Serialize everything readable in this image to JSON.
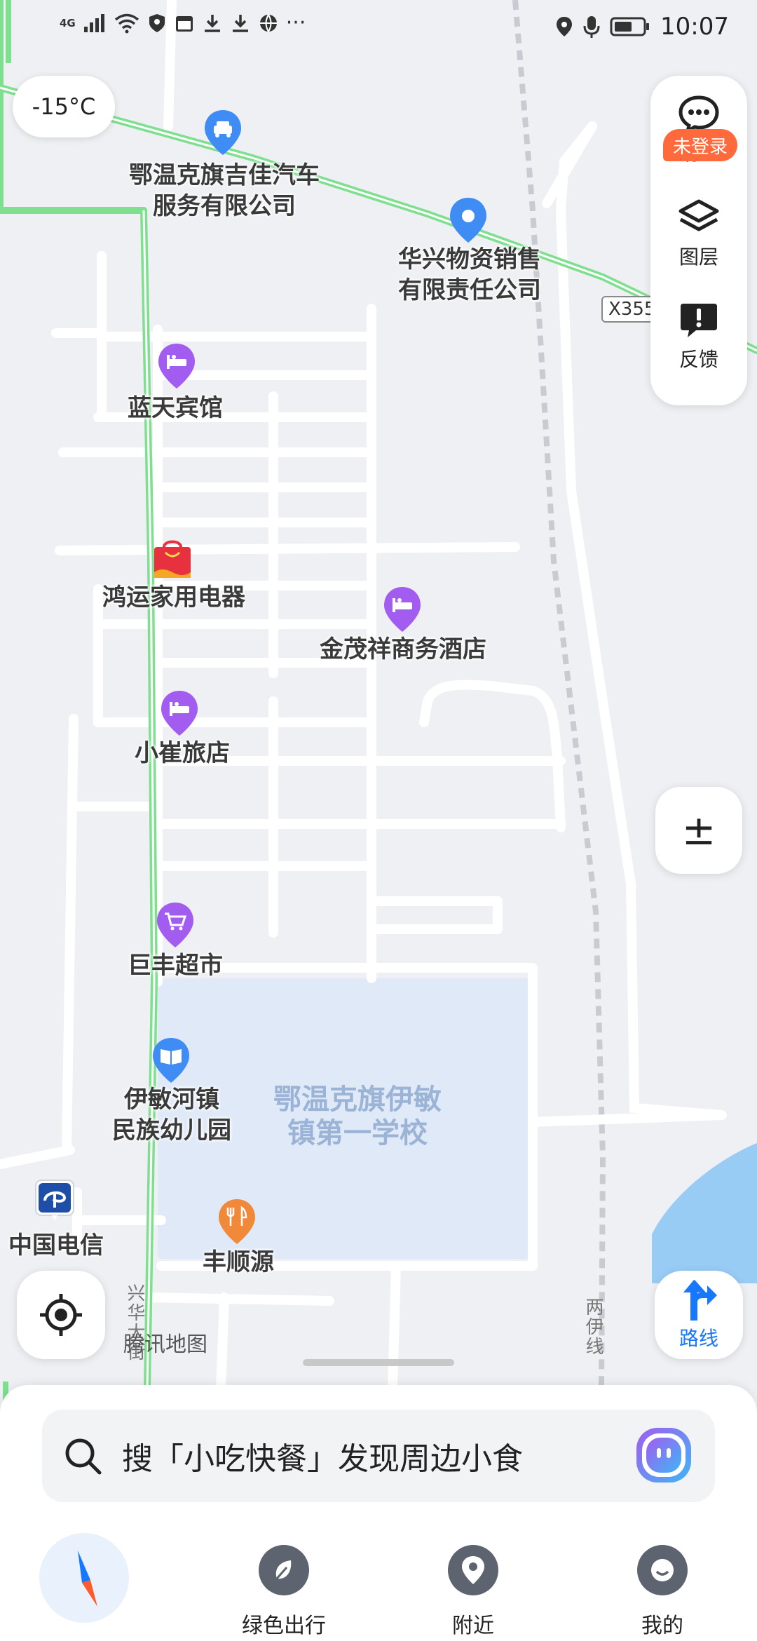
{
  "status_bar": {
    "network": "4G",
    "time": "10:07"
  },
  "weather": {
    "temperature": "-15°C"
  },
  "toolbar": {
    "messages_label": "消息",
    "layers_label": "图层",
    "feedback_label": "反馈"
  },
  "zoom": {
    "label": "±"
  },
  "route": {
    "label": "路线"
  },
  "road": {
    "label": "X355",
    "side_road_1": "兴华大街",
    "side_road_2": "两伊线"
  },
  "pois": {
    "car_company_line1": "鄂温克旗吉佳汽车",
    "car_company_line2": "服务有限公司",
    "material_company_line1": "华兴物资销售",
    "material_company_line2": "有限责任公司",
    "hotel_lantian": "蓝天宾馆",
    "appliance_store": "鸿运家用电器",
    "business_hotel": "金茂祥商务酒店",
    "inn_xiaocui": "小崔旅店",
    "supermarket": "巨丰超市",
    "kindergarten_line1": "伊敏河镇",
    "kindergarten_line2": "民族幼儿园",
    "telecom": "中国电信",
    "restaurant": "丰顺源",
    "school_line1": "鄂温克旗伊敏",
    "school_line2": "镇第一学校"
  },
  "watermark": "腾讯地图",
  "search": {
    "placeholder": "搜「小吃快餐」发现周边小食"
  },
  "nav": {
    "green_travel": "绿色出行",
    "nearby": "附近",
    "mine": "我的",
    "login_badge": "未登录"
  },
  "colors": {
    "map_bg": "#eef0f3",
    "road": "#ffffff",
    "highway": "#7ee08f",
    "water": "#99ccf5",
    "school_area": "#dfe9f8",
    "accent": "#1677ff",
    "poi_purple": "#a35cf0",
    "poi_blue": "#3f8cf5",
    "poi_orange": "#f08a3a",
    "badge": "#ff6a3d"
  }
}
